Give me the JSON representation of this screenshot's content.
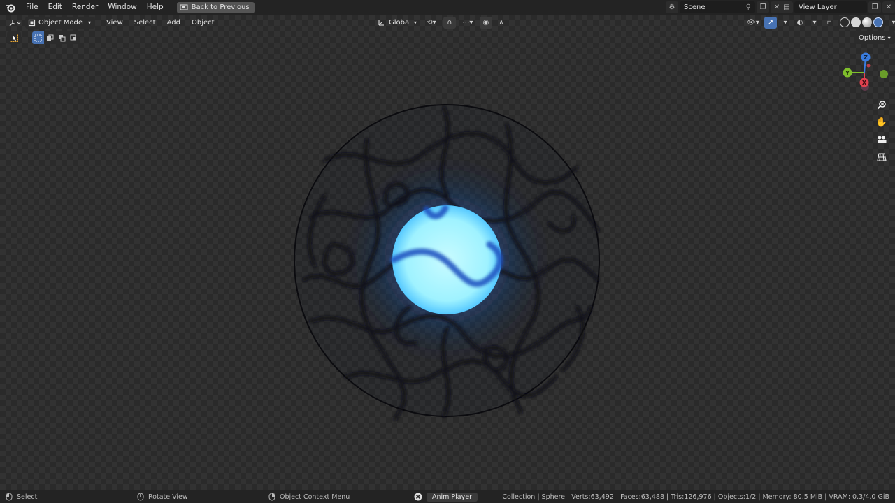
{
  "topbar": {
    "menus": [
      "File",
      "Edit",
      "Render",
      "Window",
      "Help"
    ],
    "back_button": "Back to Previous",
    "scene": "Scene",
    "view_layer": "View Layer"
  },
  "viewport_header": {
    "mode": "Object Mode",
    "menus": [
      "View",
      "Select",
      "Add",
      "Object"
    ],
    "orientation": "Global",
    "options": "Options"
  },
  "gizmo": {
    "z_label": "Z",
    "y_label": "Y",
    "x_label": "X",
    "colors": {
      "x": "#e0414f",
      "y": "#7fbf2b",
      "z": "#3a7de0"
    }
  },
  "statusbar": {
    "select": "Select",
    "rotate": "Rotate View",
    "context_menu": "Object Context Menu",
    "anim_player": "Anim Player",
    "stats": "Collection | Sphere | Verts:63,492 | Faces:63,488 | Tris:126,976 | Objects:1/2 | Memory: 80.5 MiB | VRAM: 0.3/4.0 GiB"
  },
  "colors": {
    "accent": "#4772b3",
    "orb_core": "#9ff2ff",
    "orb_glow": "#3cc6ff"
  }
}
